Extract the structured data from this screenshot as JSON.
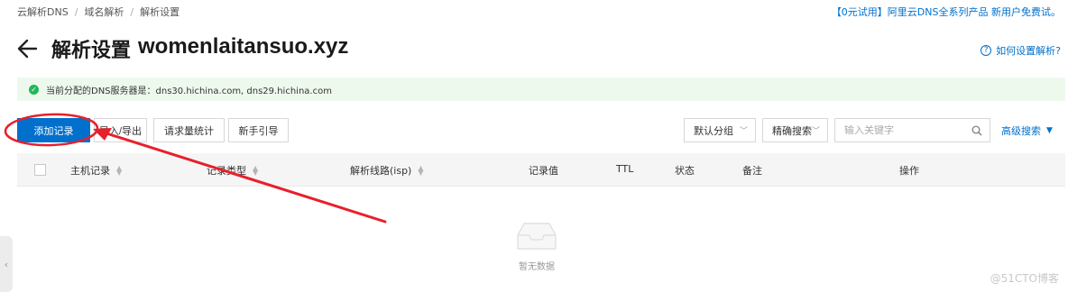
{
  "breadcrumb": [
    "云解析DNS",
    "域名解析",
    "解析设置"
  ],
  "promo": "【0元试用】阿里云DNS全系列产品 新用户免费试。",
  "page": {
    "title": "解析设置",
    "domain": "womenlaitansuo.xyz"
  },
  "help": {
    "label": "如何设置解析?"
  },
  "notice": {
    "text": "当前分配的DNS服务器是：dns30.hichina.com, dns29.hichina.com"
  },
  "toolbar": {
    "add_record": "添加记录",
    "import_export": "导入/导出",
    "request_stats": "请求量统计",
    "guide": "新手引导",
    "group_filter": "默认分组",
    "search_mode": "精确搜索",
    "search_placeholder": "输入关键字",
    "advanced_search": "高级搜索"
  },
  "table": {
    "columns": [
      "主机记录",
      "记录类型",
      "解析线路(isp)",
      "记录值",
      "TTL",
      "状态",
      "备注",
      "操作"
    ],
    "empty_text": "暂无数据"
  },
  "watermark": "@51CTO博客",
  "colors": {
    "accent": "#0070cc",
    "annotation": "#e8202a",
    "success": "#1db85b",
    "notice_bg": "#eef9ee"
  }
}
